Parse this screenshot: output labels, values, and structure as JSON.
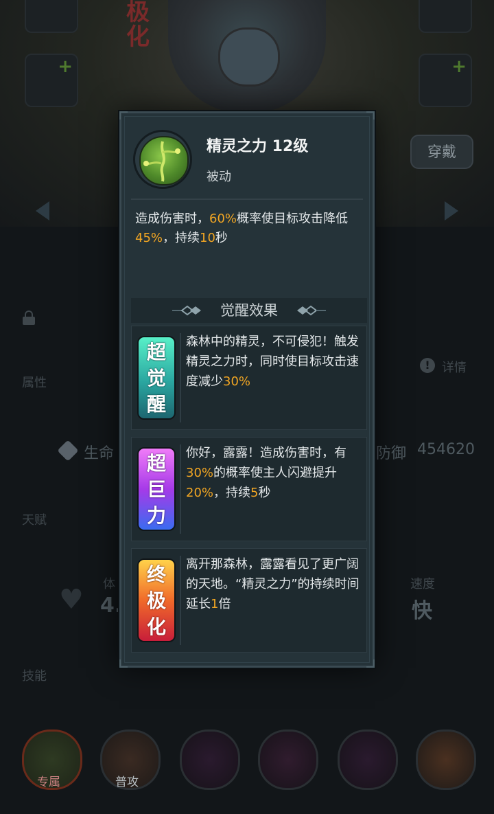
{
  "background": {
    "top_vertical_text": "极化",
    "wear_button": "穿戴",
    "labels": {
      "attributes": "属性",
      "talent": "天赋",
      "skills": "技能",
      "details": "详情",
      "speed_label": "速度",
      "speed_value": "快",
      "body_label_partial": "体",
      "body_value_partial": "4.",
      "hp_label": "生命",
      "defense_label": "防御",
      "defense_value": "454620"
    },
    "skill_bar": {
      "slot1_label": "专属",
      "slot2_label": "普攻"
    }
  },
  "popup": {
    "skill_name": "精灵之力 12级",
    "skill_type": "被动",
    "description": {
      "p1": "造成伤害时，",
      "v1": "60%",
      "p2": "概率使目标攻击降低",
      "v2": "45%",
      "p3": "，持续",
      "v3": "10",
      "p4": "秒"
    },
    "awakening_header": "觉醒效果",
    "effects": [
      {
        "badge": [
          "超",
          "觉",
          "醒"
        ],
        "text_a": "森林中的精灵，不可侵犯！触发精灵之力时，同时使目标攻击速度减少",
        "v1": "30%"
      },
      {
        "badge": [
          "超",
          "巨",
          "力"
        ],
        "text_a": "你好，露露！造成伤害时，有",
        "v1": "30%",
        "text_b": "的概率使主人闪避提升",
        "v2": "20%",
        "text_c": "，持续",
        "v3": "5",
        "text_d": "秒"
      },
      {
        "badge": [
          "终",
          "极",
          "化"
        ],
        "text_a": "离开那森林，露露看见了更广阔的天地。“精灵之力”的持续时间延长",
        "v1": "1",
        "text_b": "倍"
      }
    ]
  },
  "colors": {
    "highlight": "#f2a623",
    "popup_bg": "#253339",
    "card_bg": "#1e2a2f"
  }
}
